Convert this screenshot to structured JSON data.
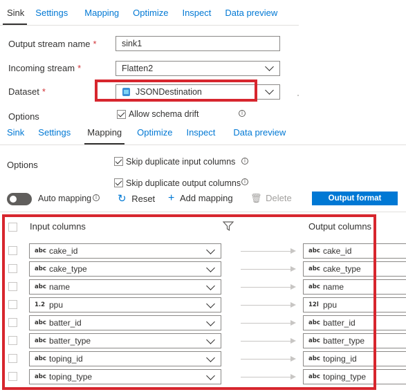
{
  "top_tabs": [
    "Sink",
    "Settings",
    "Mapping",
    "Optimize",
    "Inspect",
    "Data preview"
  ],
  "form": {
    "output_stream_label": "Output stream name",
    "output_stream_value": "sink1",
    "incoming_stream_label": "Incoming stream",
    "incoming_stream_value": "Flatten2",
    "dataset_label": "Dataset",
    "dataset_value": "JSONDestination",
    "options_label": "Options",
    "allow_schema_drift": "Allow schema drift",
    "required_mark": "*"
  },
  "second_tabs": [
    "Sink",
    "Settings",
    "Mapping",
    "Optimize",
    "Inspect",
    "Data preview"
  ],
  "mapping": {
    "options_label": "Options",
    "skip_input": "Skip duplicate input columns",
    "skip_output": "Skip duplicate output columns",
    "auto_mapping": "Auto mapping",
    "reset": "Reset",
    "add_mapping": "Add mapping",
    "delete": "Delete",
    "output_format": "Output format",
    "input_columns_header": "Input columns",
    "output_columns_header": "Output columns",
    "rows": [
      {
        "in_type": "abc",
        "in": "cake_id",
        "out_type": "abc",
        "out": "cake_id"
      },
      {
        "in_type": "abc",
        "in": "cake_type",
        "out_type": "abc",
        "out": "cake_type"
      },
      {
        "in_type": "abc",
        "in": "name",
        "out_type": "abc",
        "out": "name"
      },
      {
        "in_type": "1.2",
        "in": "ppu",
        "out_type": "12l",
        "out": "ppu"
      },
      {
        "in_type": "abc",
        "in": "batter_id",
        "out_type": "abc",
        "out": "batter_id"
      },
      {
        "in_type": "abc",
        "in": "batter_type",
        "out_type": "abc",
        "out": "batter_type"
      },
      {
        "in_type": "abc",
        "in": "toping_id",
        "out_type": "abc",
        "out": "toping_id"
      },
      {
        "in_type": "abc",
        "in": "toping_type",
        "out_type": "abc",
        "out": "toping_type"
      }
    ]
  },
  "colors": {
    "accent": "#0078d4",
    "highlight": "#d7262e"
  }
}
